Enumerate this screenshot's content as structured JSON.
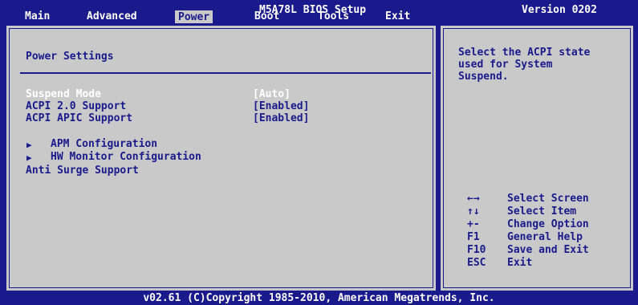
{
  "header": {
    "title": "M5A78L BIOS Setup",
    "version": "Version 0202",
    "tabs": [
      {
        "label": "Main"
      },
      {
        "label": "Advanced"
      },
      {
        "label": "Power"
      },
      {
        "label": "Boot"
      },
      {
        "label": "Tools"
      },
      {
        "label": "Exit"
      }
    ],
    "active_tab": "Power"
  },
  "main": {
    "section_title": "Power Settings",
    "items": [
      {
        "label": "Suspend Mode",
        "value": "[Auto]"
      },
      {
        "label": "ACPI 2.0 Support",
        "value": "[Enabled]"
      },
      {
        "label": "ACPI APIC Support",
        "value": "[Enabled]"
      }
    ],
    "submenus": [
      {
        "label": "APM Configuration"
      },
      {
        "label": "HW Monitor Configuration"
      }
    ],
    "extra_item": {
      "label": "Anti Surge Support"
    }
  },
  "help": {
    "description": "Select the ACPI state\nused for System\nSuspend.",
    "keys": [
      {
        "key": "←→",
        "action": "Select Screen"
      },
      {
        "key": "↑↓",
        "action": "Select Item"
      },
      {
        "key": "+-",
        "action": "Change Option"
      },
      {
        "key": "F1",
        "action": "General Help"
      },
      {
        "key": "F10",
        "action": "Save and Exit"
      },
      {
        "key": "ESC",
        "action": "Exit"
      }
    ]
  },
  "footer": {
    "copyright": "v02.61 (C)Copyright 1985-2010, American Megatrends, Inc."
  },
  "colors": {
    "background": "#1a1a8c",
    "panel": "#c9c9c9",
    "highlight_text": "#ffffff"
  }
}
